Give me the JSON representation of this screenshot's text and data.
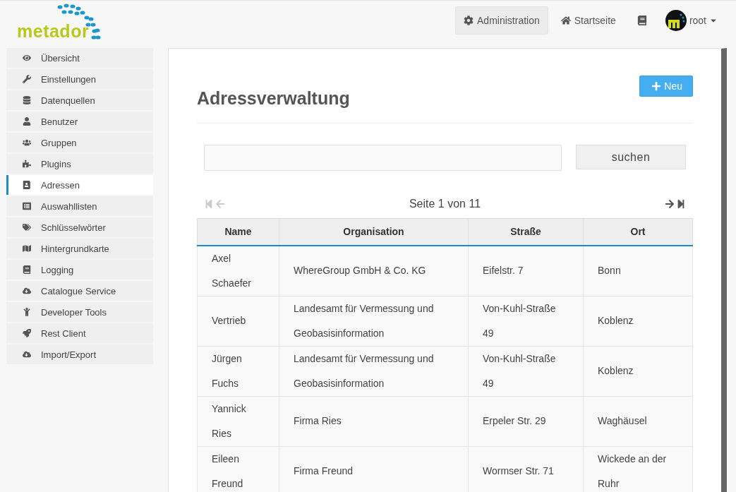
{
  "logo": {
    "text": "metador"
  },
  "topnav": [
    {
      "label": "Administration",
      "selected": true
    },
    {
      "label": "Startseite",
      "selected": false
    },
    {
      "selected": false
    }
  ],
  "user": {
    "name": "root"
  },
  "sidebar": {
    "items": [
      {
        "label": "Übersicht",
        "selected": false
      },
      {
        "label": "Einstellungen",
        "selected": false
      },
      {
        "label": "Datenquellen",
        "selected": false
      },
      {
        "label": "Benutzer",
        "selected": false
      },
      {
        "label": "Gruppen",
        "selected": false
      },
      {
        "label": "Plugins",
        "selected": false
      },
      {
        "label": "Adressen",
        "selected": true
      },
      {
        "label": "Auswahllisten",
        "selected": false
      },
      {
        "label": "Schlüsselwörter",
        "selected": false
      },
      {
        "label": "Hintergrundkarte",
        "selected": false
      },
      {
        "label": "Logging",
        "selected": false
      },
      {
        "label": "Catalogue Service",
        "selected": false
      },
      {
        "label": "Developer Tools",
        "selected": false
      },
      {
        "label": "Rest Client",
        "selected": false
      },
      {
        "label": "Import/Export",
        "selected": false
      }
    ]
  },
  "page": {
    "title": "Adressverwaltung",
    "new_button": "Neu"
  },
  "search": {
    "button": "suchen"
  },
  "pager": {
    "text": "Seite 1 von 11",
    "first_disabled": true,
    "prev_disabled": true,
    "next_disabled": false,
    "last_disabled": false
  },
  "table": {
    "columns": [
      "Name",
      "Organisation",
      "Straße",
      "Ort"
    ],
    "rows": [
      {
        "name": [
          "Axel",
          "Schaefer"
        ],
        "organisation": [
          "WhereGroup GmbH & Co. KG"
        ],
        "street": [
          "Eifelstr. 7"
        ],
        "city": [
          "Bonn"
        ]
      },
      {
        "name": [
          "Vertrieb"
        ],
        "organisation": [
          "Landesamt für Vermessung und",
          "Geobasisinformation"
        ],
        "street": [
          "Von-Kuhl-Straße",
          "49"
        ],
        "city": [
          "Koblenz"
        ]
      },
      {
        "name": [
          "Jürgen",
          "Fuchs"
        ],
        "organisation": [
          "Landesamt für Vermessung und",
          "Geobasisinformation"
        ],
        "street": [
          "Von-Kuhl-Straße",
          "49"
        ],
        "city": [
          "Koblenz"
        ]
      },
      {
        "name": [
          "Yannick",
          "Ries"
        ],
        "organisation": [
          "Firma Ries"
        ],
        "street": [
          "Erpeler Str. 29"
        ],
        "city": [
          "Waghäusel"
        ]
      },
      {
        "name": [
          "Eileen",
          "Freund"
        ],
        "organisation": [
          "Firma Freund"
        ],
        "street": [
          "Wormser Str. 71"
        ],
        "city": [
          "Wickede an der",
          "Ruhr"
        ]
      }
    ]
  }
}
